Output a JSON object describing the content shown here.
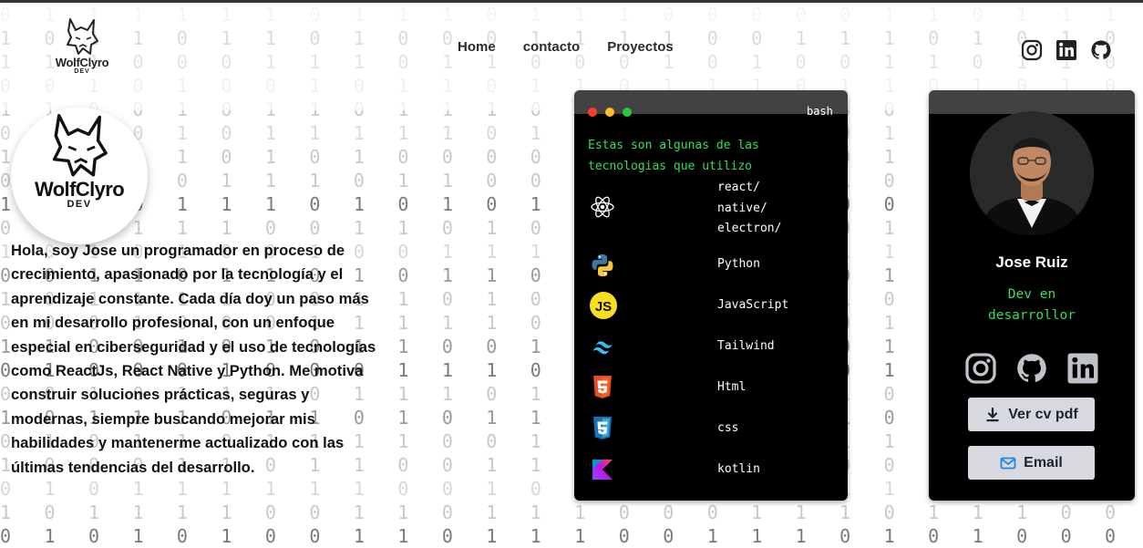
{
  "nav": {
    "brand": "WolfClyro",
    "brand_sub": "DEV",
    "links": [
      "Home",
      "contacto",
      "Proyectos"
    ],
    "social": [
      "instagram-icon",
      "linkedin-icon",
      "github-icon"
    ]
  },
  "hero": {
    "brand": "WolfClyro",
    "brand_sub": "DEV",
    "intro": "Hola, soy Jose un programador en proceso de crecimiento, apasionado por la tecnología y el aprendizaje constante. Cada día doy un paso más en mi desarrollo profesional, con un enfoque especial en ciberseguridad y el uso de tecnologías como ReactJs, React Native y Python. Me motiva construir soluciones prácticas, seguras y modernas, siempre buscando mejorar mis habilidades y mantenerme actualizado con las últimas tendencias del desarrollo."
  },
  "terminal": {
    "title": "bash",
    "intro": "Estas son algunas de las tecnologias que utilizo",
    "techs": [
      {
        "label": "react/\nnative/\nelectron/",
        "icon": "react-icon"
      },
      {
        "label": "Python",
        "icon": "python-icon"
      },
      {
        "label": "JavaScript",
        "icon": "javascript-icon"
      },
      {
        "label": "Tailwind",
        "icon": "tailwind-icon"
      },
      {
        "label": "Html",
        "icon": "html5-icon"
      },
      {
        "label": "css",
        "icon": "css3-icon"
      },
      {
        "label": "kotlin",
        "icon": "kotlin-icon"
      }
    ]
  },
  "profile": {
    "name": "Jose Ruiz",
    "role": "Dev en desarrollor",
    "social": [
      "instagram-icon",
      "github-icon",
      "linkedin-icon"
    ],
    "cv_label": "Ver cv pdf",
    "email_label": "Email"
  },
  "colors": {
    "terminal_bg": "#000000",
    "terminal_green": "#2fe05c",
    "button_bg": "#d7d9de",
    "email_icon": "#1e88e5"
  },
  "background": {
    "rows": [
      "0 1 1 1 1 1 1 0 1 1 1 0 1 1 1 0 0 0 0 0 1 1 0 1 1 1 1 1 0 0 0 1 1 1 1 0 0 0 0 1 1 1 0 0 0 0 1 1 0 0",
      "1 0 1 1 0 1 1 0 1 0 0 0 1 1 1 1 0 0 1 1 1 0 1 0 1 0 0 0 0 0 0 1 1 1 0 0 0 0 1 1 0 0 0 1 0 0 1 0 1 1",
      "1 1 1 0 0 0 1 1 1 0 1 1 0 0 0 1 0 1 0 0 1 1 0 1 1 0 1 1 1 0 0 0 1 0 0 0 0 1 1 1 0 0 1 0 0 0 0 0 0 1",
      "0 0 1 0 1 0 0 1 0 1 1 0 1 1 0 1 1 1 0 1 1 0 1 0 1 0 1 1 1 0 0 1 1 0 1 0 0 0 0 1 0 1 0 1 1 0 1 1 0 0",
      "1 1 0 0 1 0 1 1 0 1 1 1 0 1 1 1 1 0 1 0 0 0 1 0 1 1 0 1 1 1 0 0 1 1 0 0 1 0 1 1 0 1 1 1 1 1 1 0 0 1",
      "0 1 1 0 1 0 1 1 1 1 1 0 1 1 0 0 0 0 0 0 1 1 0 0 0 0 0 1 0 1 0 1 0 1 1 1 0 1 1 1 1 1 0 1 0 1 1 0 1 0",
      "1 0 0 1 1 0 1 0 1 0 0 0 0 0 0 1 0 1 1 0 1 0 0 1 0 0 1 0 1 0 0 1 1 0 1 0 0 0 1 1 0 1 0 1 0 1 0 0 0 1",
      "0 1 0 1 0 1 1 1 0 1 1 0 0 0 1 1 1 1 0 1 0 1 0 1 1 1 1 0 1 1 1 0 1 1 0 1 1 1 0 0 1 0 1 1 0 0 1 1 1 0",
      "1 1 1 0 1 1 1 0 1 0 1 0 1 0 0 1 1 1 1 0 0 1 1 0 1 0 0 1 0 0 1 0 1 1 0 1 0 0 0 1 1 0 1 1 1 0 1 0 1 1",
      "0 1 1 1 1 1 0 0 1 1 0 1 0 1 1 0 1 0 0 0 1 1 1 1 1 0 1 1 0 1 1 0 1 0 1 1 1 0 0 1 1 0 1 1 1 0 1 0 1 0",
      "1 0 1 0 1 0 0 1 0 0 1 1 1 1 1 0 1 0 0 1 1 1 0 1 0 1 0 1 1 0 0 0 0 1 0 1 0 1 0 0 0 0 1 0 1 0 1 1 0 1",
      "0 0 1 1 0 1 1 0 1 0 1 1 0 0 0 1 0 0 0 0 1 1 0 1 1 0 1 0 0 1 0 1 0 1 1 1 1 0 1 0 1 0 1 1 1 0 1 0 0 1",
      "1 0 1 1 1 1 0 0 1 1 0 1 0 0 1 1 0 1 0 1 0 1 1 1 1 0 1 0 1 0 1 0 1 0 0 0 1 0 1 0 0 1 0 1 1 0 1 0 1 0",
      "0 0 0 1 0 0 0 1 1 1 1 1 0 1 0 0 0 1 1 0 1 1 1 0 1 0 1 1 1 0 0 1 1 1 0 0 1 1 0 0 1 1 0 1 0 1 1 0 1 0",
      "1 1 0 0 1 0 1 0 1 1 0 0 1 0 1 0 1 1 1 0 1 0 0 1 1 1 1 1 1 0 0 1 1 1 1 0 1 0 1 1 1 0 0 1 1 1 0 0 1 0",
      "0 1 0 0 0 1 0 0 0 1 1 1 0 0 1 0 0 1 0 0 1 1 1 1 1 0 1 1 1 1 1 0 0 0 1 1 1 0 1 0 1 1 0 1 0 1 0 0 1 1",
      "0 0 1 0 1 1 1 0 1 1 1 0 1 1 1 1 0 1 1 1 0 1 0 1 0 0 1 0 0 1 1 0 1 1 0 1 0 0 0 1 1 0 0 1 0 0 0 1 0 1",
      "1 0 1 1 1 0 1 1 0 1 0 1 1 1 1 0 1 1 1 1 0 1 0 1 0 0 1 1 0 0 0 0 1 1 1 0 1 0 1 1 0 0 0 0 1 1 0 1 1 0",
      "0 1 0 1 1 0 1 1 1 1 0 0 1 0 1 1 1 0 1 1 1 0 1 1 1 1 0 0 0 0 0 0 1 1 0 1 1 1 0 0 1 0 0 1 1 1 1 0 0 1",
      "1 0 0 0 1 1 0 1 1 0 0 1 1 0 1 0 1 1 1 0 0 0 1 1 0 1 1 1 0 1 0 0 0 0 1 1 1 1 1 1 0 1 0 1 0 0 1 1 1 0",
      "0 1 0 1 1 1 1 1 1 0 0 1 0 0 0 1 0 1 0 1 1 0 1 1 0 0 0 1 1 0 1 1 1 1 1 0 1 0 1 1 0 0 1 0 0 0 1 0 1 0",
      "1 0 1 1 1 1 0 0 1 1 0 1 1 1 0 0 0 1 1 1 0 1 1 1 0 0 1 1 1 1 1 1 0 1 0 1 0 1 0 1 1 0 1 1 1 1 0 1 0 0",
      "0 1 0 1 0 1 0 0 1 1 0 1 1 1 0 0 1 1 1 0 1 0 1 0 0 0 0 1 0 1 0 0 1 1 1 0 1 0 0 1 1 0 0 1 1 0 0 0 1 1"
    ]
  }
}
